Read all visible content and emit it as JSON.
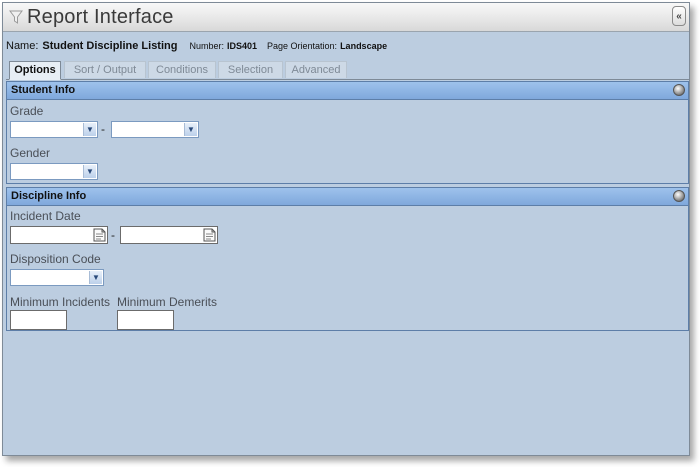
{
  "window": {
    "title": "Report Interface",
    "collapse_label": "«"
  },
  "report": {
    "name_label": "Name:",
    "name": "Student Discipline Listing",
    "number_label": "Number:",
    "number": "IDS401",
    "orientation_label": "Page Orientation:",
    "orientation": "Landscape"
  },
  "tabs": [
    {
      "label": "Options",
      "active": true
    },
    {
      "label": "Sort / Output",
      "active": false
    },
    {
      "label": "Conditions",
      "active": false
    },
    {
      "label": "Selection",
      "active": false
    },
    {
      "label": "Advanced",
      "active": false
    }
  ],
  "student_info": {
    "title": "Student Info",
    "grade_label": "Grade",
    "grade_from": "",
    "grade_to": "",
    "range_separator": "-",
    "gender_label": "Gender",
    "gender_value": ""
  },
  "discipline_info": {
    "title": "Discipline Info",
    "incident_date_label": "Incident Date",
    "incident_date_from": "",
    "incident_date_to": "",
    "range_separator": "-",
    "disposition_code_label": "Disposition Code",
    "disposition_code_value": "",
    "min_incidents_label": "Minimum Incidents",
    "min_incidents_value": "",
    "min_demerits_label": "Minimum Demerits",
    "min_demerits_value": ""
  },
  "colors": {
    "window_bg": "#bccde0",
    "section_header": "#8fb6e6",
    "border": "#5d7ea8"
  },
  "icons": {
    "title": "funnel-icon",
    "collapse": "double-chevron-left-icon",
    "section_toggle": "orb-icon",
    "select_arrow": "chevron-down-icon",
    "date_picker": "calendar-icon"
  }
}
